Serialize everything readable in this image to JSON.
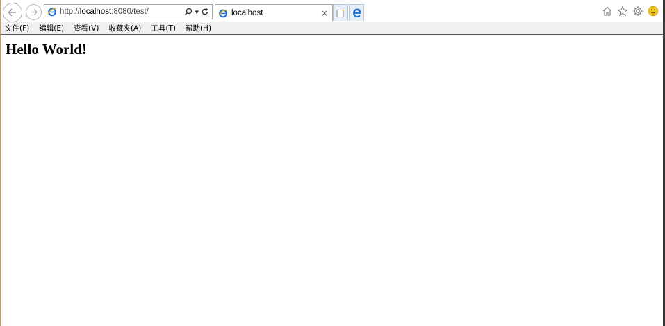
{
  "browser": {
    "address": {
      "prefix": "http://",
      "host": "localhost",
      "suffix": ":8080/test/"
    },
    "tab": {
      "title": "localhost",
      "close_glyph": "×"
    },
    "addr_tools": {
      "search_glyph": "⌕",
      "dropdown_glyph": "▾",
      "refresh_glyph": "↻"
    },
    "icons": {
      "back": "back-arrow-icon",
      "forward": "forward-arrow-icon",
      "site": "ie-icon",
      "new_tab": "new-tab-icon",
      "edge": "edge-icon",
      "home": "home-icon",
      "favorites": "star-icon",
      "settings": "gear-icon",
      "feedback": "smiley-icon"
    },
    "colors": {
      "ie_blue": "#1f6fd1",
      "ie_gold": "#e8b31b",
      "smiley": "#f2c81b",
      "menubar_bg": "#f0f0f0"
    }
  },
  "menubar": {
    "items": [
      "文件(F)",
      "编辑(E)",
      "查看(V)",
      "收藏夹(A)",
      "工具(T)",
      "帮助(H)"
    ]
  },
  "page": {
    "heading": "Hello World!"
  }
}
